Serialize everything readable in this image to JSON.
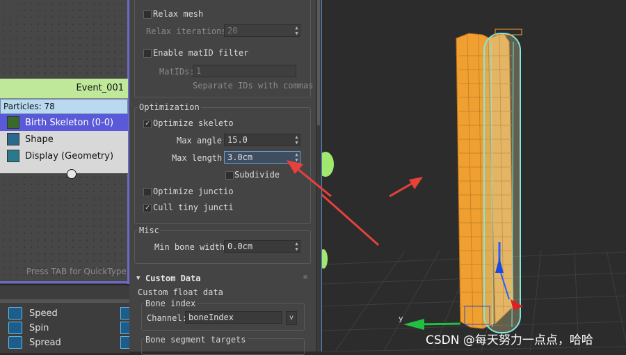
{
  "particle_view": {
    "event_name": "Event_001",
    "particles_label": "Particles: 78",
    "operators": [
      {
        "label": "Birth Skeleton (0-0)",
        "selected": true
      },
      {
        "label": "Shape",
        "selected": false
      },
      {
        "label": "Display (Geometry)",
        "selected": false
      }
    ],
    "quicktype_hint": "Press TAB for QuickType"
  },
  "depot": {
    "items": [
      "Speed",
      "Spin",
      "Spread"
    ]
  },
  "params": {
    "relax_mesh_label": "Relax mesh",
    "relax_iterations_label": "Relax iterations:",
    "relax_iterations_value": "20",
    "matid_filter_label": "Enable matID filter",
    "matids_label": "MatIDs:",
    "matids_value": "1",
    "matids_hint": "Separate IDs with commas",
    "optimization": {
      "title": "Optimization",
      "optimize_skeleton_label": "Optimize skeleto",
      "max_angle_label": "Max angle:",
      "max_angle_value": "15.0",
      "max_length_label": "Max length:",
      "max_length_value": "3.0cm",
      "subdivide_label": "Subdivide",
      "optimize_junctions_label": "Optimize junctio",
      "cull_tiny_label": "Cull tiny juncti"
    },
    "misc": {
      "title": "Misc",
      "min_bone_width_label": "Min bone width:",
      "min_bone_width_value": "0.0cm"
    },
    "custom_data": {
      "rollout_title": "Custom Data",
      "custom_float_label": "Custom float data",
      "bone_index_title": "Bone index",
      "channel_label": "Channel:",
      "channel_value": "boneIndex",
      "channel_button": "v",
      "bone_segment_title": "Bone segment targets"
    }
  },
  "viewport": {
    "axis_y_label": "y",
    "watermark": "CSDN @每天努力一点点，哈哈"
  },
  "colors": {
    "event_header": "#bfe89a",
    "selection": "#5a5ad8",
    "arrow": "#e8413c",
    "mesh_orange": "#f0a030",
    "mesh_cyan": "#7fe8e0"
  }
}
